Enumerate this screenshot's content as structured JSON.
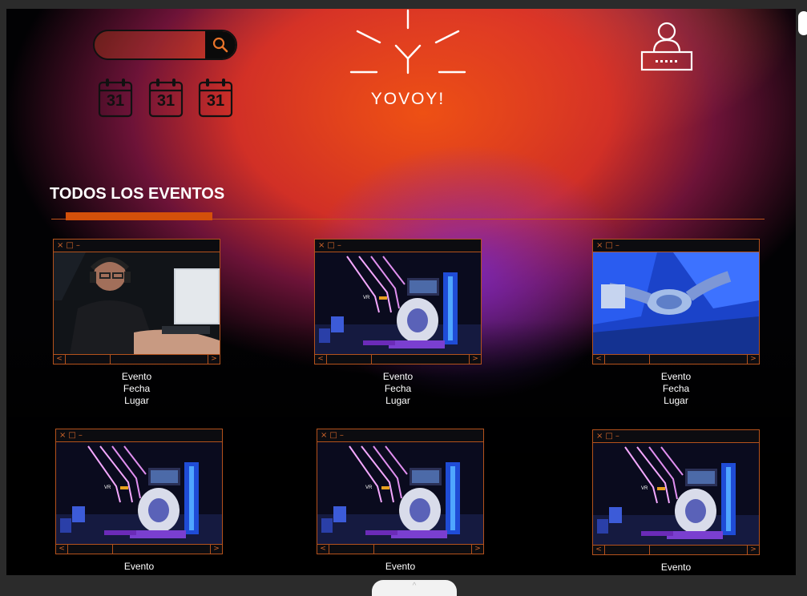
{
  "brand": {
    "name": "YOVOY!"
  },
  "search": {
    "placeholder": "",
    "value": ""
  },
  "calendar_icons": [
    "31",
    "31",
    "31"
  ],
  "section": {
    "title": "TODOS LOS EVENTOS"
  },
  "window_controls": {
    "close": "×",
    "maximize": "□",
    "minimize": "–",
    "prev": "<",
    "next": ">"
  },
  "events": [
    {
      "name": "Evento",
      "date": "Fecha",
      "place": "Lugar",
      "image": "gamer-headset"
    },
    {
      "name": "Evento",
      "date": "Fecha",
      "place": "Lugar",
      "image": "vr-motorbike"
    },
    {
      "name": "Evento",
      "date": "Fecha",
      "place": "Lugar",
      "image": "controller-hands"
    },
    {
      "name": "Evento",
      "date": "",
      "place": "",
      "image": "vr-motorbike"
    },
    {
      "name": "Evento",
      "date": "",
      "place": "",
      "image": "vr-motorbike"
    },
    {
      "name": "Evento",
      "date": "",
      "place": "",
      "image": "vr-motorbike"
    }
  ],
  "colors": {
    "accent": "#d4500a",
    "frame": "#b4521c",
    "background": "#020204"
  }
}
